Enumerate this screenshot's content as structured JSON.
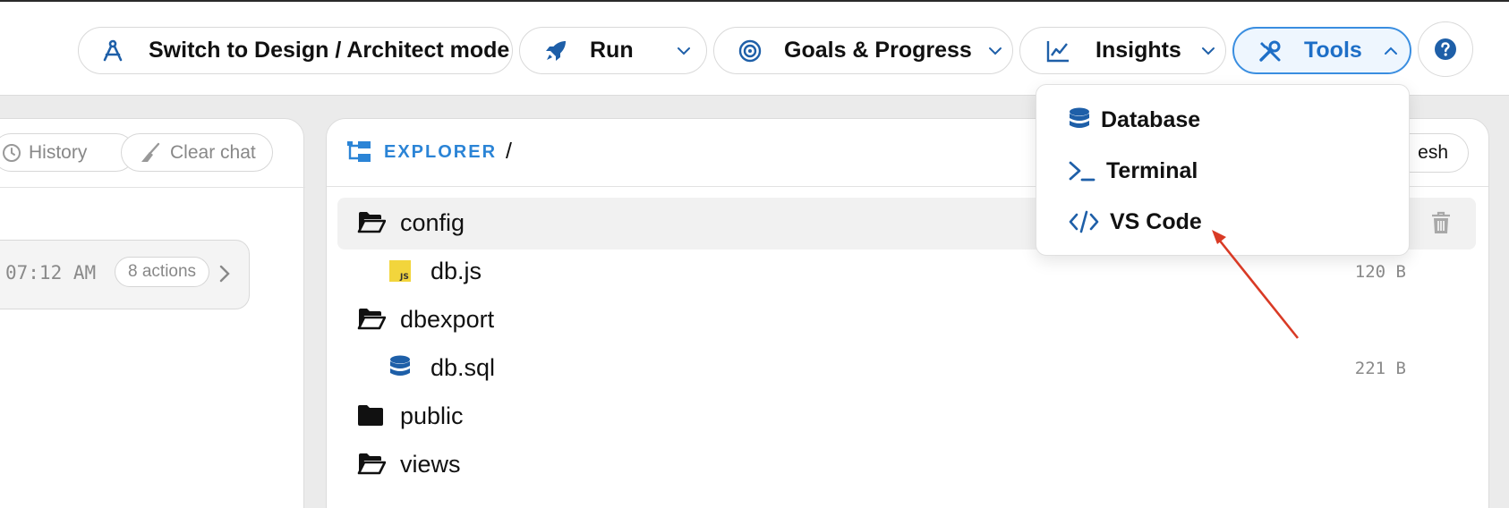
{
  "toolbar": {
    "mode_button": "Switch to Design / Architect mode",
    "run_button": "Run",
    "goals_button": "Goals & Progress",
    "insights_button": "Insights",
    "tools_button": "Tools"
  },
  "tools_menu": {
    "items": [
      {
        "label": "Database",
        "icon": "database-icon"
      },
      {
        "label": "Terminal",
        "icon": "terminal-icon"
      },
      {
        "label": "VS Code",
        "icon": "code-icon"
      }
    ]
  },
  "chat_panel": {
    "history_button": "History",
    "clear_button": "Clear chat",
    "message": {
      "time": "07:12 AM",
      "actions": "8 actions"
    }
  },
  "explorer": {
    "title": "EXPLORER",
    "path": "/",
    "refresh_button": "esh",
    "tree": [
      {
        "name": "config",
        "type": "folder-open",
        "size": ""
      },
      {
        "name": "db.js",
        "type": "js-file",
        "size": "120 B"
      },
      {
        "name": "dbexport",
        "type": "folder-open",
        "size": ""
      },
      {
        "name": "db.sql",
        "type": "database-file",
        "size": "221 B"
      },
      {
        "name": "public",
        "type": "folder",
        "size": ""
      },
      {
        "name": "views",
        "type": "folder-open",
        "size": ""
      }
    ]
  },
  "colors": {
    "accent": "#1e6fc7",
    "accent_bg": "#eef6fe",
    "annotation_arrow": "#d93a25"
  }
}
